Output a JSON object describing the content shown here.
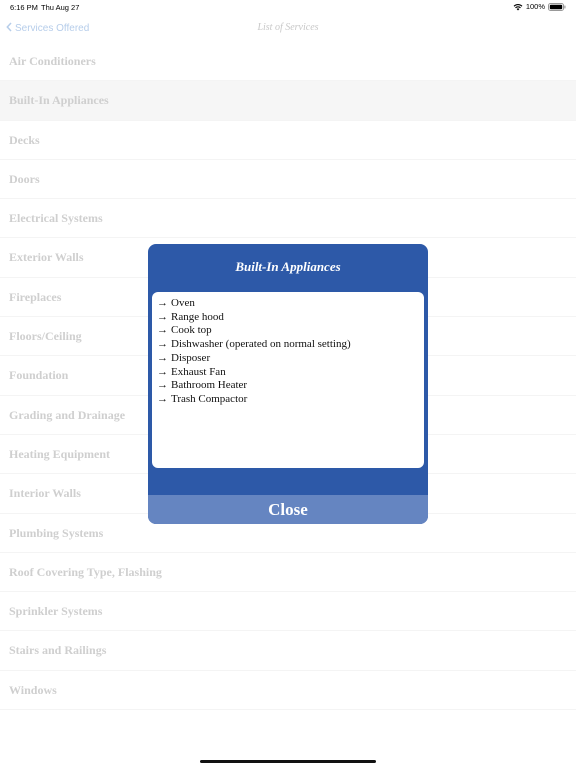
{
  "status_bar": {
    "time": "6:16 PM",
    "date": "Thu Aug 27",
    "battery": "100%"
  },
  "nav": {
    "back_label": "Services Offered",
    "title": "List of Services"
  },
  "services": [
    {
      "label": "Air Conditioners"
    },
    {
      "label": "Built-In Appliances"
    },
    {
      "label": "Decks"
    },
    {
      "label": "Doors"
    },
    {
      "label": "Electrical Systems"
    },
    {
      "label": "Exterior Walls"
    },
    {
      "label": "Fireplaces"
    },
    {
      "label": "Floors/Ceiling"
    },
    {
      "label": "Foundation"
    },
    {
      "label": "Grading and Drainage"
    },
    {
      "label": "Heating Equipment"
    },
    {
      "label": "Interior Walls"
    },
    {
      "label": "Plumbing Systems"
    },
    {
      "label": "Roof Covering Type, Flashing"
    },
    {
      "label": "Sprinkler Systems"
    },
    {
      "label": "Stairs and Railings"
    },
    {
      "label": "Windows"
    }
  ],
  "modal": {
    "title": "Built-In Appliances",
    "arrow": "→",
    "items": [
      "Oven",
      "Range hood",
      "Cook top",
      "Dishwasher (operated on normal setting)",
      "Disposer",
      "Exhaust Fan",
      "Bathroom Heater",
      "Trash Compactor"
    ],
    "close_label": "Close"
  },
  "colors": {
    "modal_bg": "#2d59a8",
    "close_bg": "#6585c1",
    "back_link": "#b6cdea"
  }
}
